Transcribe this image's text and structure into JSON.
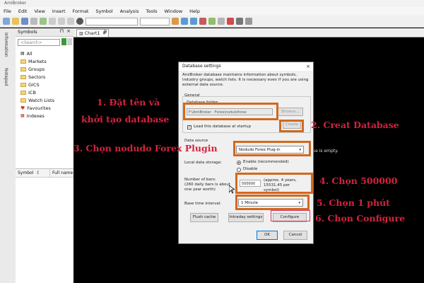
{
  "app": {
    "title": "AmiBroker"
  },
  "menu": [
    "File",
    "Edit",
    "View",
    "Insert",
    "Format",
    "Symbol",
    "Analysis",
    "Tools",
    "Window",
    "Help"
  ],
  "side_tabs": [
    "Information",
    "Notepad"
  ],
  "symbols_panel": {
    "title": "Symbols",
    "search_placeholder": "<Search>",
    "tree": [
      "All",
      "Markets",
      "Groups",
      "Sectors",
      "GICS",
      "ICB",
      "Watch Lists",
      "Favourites",
      "Indexes"
    ],
    "list_columns": [
      "Symbol",
      "Full name"
    ]
  },
  "chart_tab": "Chart1",
  "dialog": {
    "title": "Database settings",
    "intro": "AmiBroker database maintains information about symbols, industry groups, watch lists. It is necessary even if you are using external data source.",
    "general_label": "General",
    "folder_label": "Database folder:",
    "folder_value": "F:\\AmiBroker - Forex\\noduloforex",
    "browse_button": "Browse...",
    "create_button": "Create",
    "load_startup_label": "Load this database at startup",
    "data_source_label": "Data source",
    "data_source_value": "Nodudo Forex Plug-in",
    "local_storage_label": "Local data storage:",
    "enable_label": "Enable (recommended)",
    "disable_label": "Disable",
    "bars_label": "Number of bars:",
    "bars_note": "(260 daily bars is about one year worth)",
    "bars_value": "500000",
    "bars_approx": "(approx. 4 years, 15531.45 per symbol)",
    "interval_label": "Base time interval:",
    "interval_value": "1 Minute",
    "flush_button": "Flush cache",
    "intraday_button": "Intraday settings",
    "configure_button": "Configure",
    "ok_button": "OK",
    "cancel_button": "Cancel",
    "behind_text": "se is empty."
  },
  "annotations": {
    "step1_line1": "1. Đặt tên và",
    "step1_line2": "khởi tạo database",
    "step2": "2. Creat Database",
    "step3": "3. Chọn nodudo Forex Plugin",
    "step4": "4. Chọn 500000",
    "step5": "5. Chọn 1 phút",
    "step6": "6. Chọn Configure"
  },
  "colors": {
    "annotation_text": "#d3233e",
    "highlight_box": "#d2691e",
    "chart_bg": "#000000"
  }
}
